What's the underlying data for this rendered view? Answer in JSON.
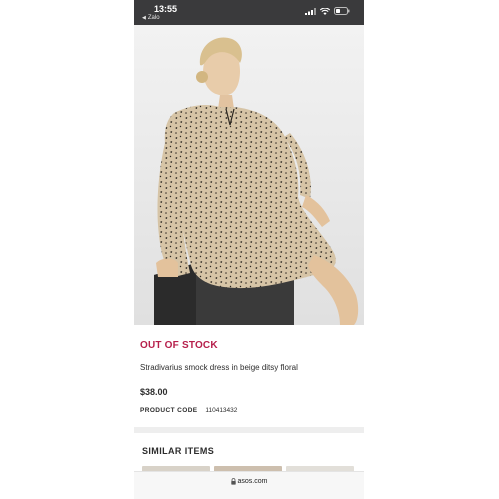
{
  "status_bar": {
    "time": "13:55",
    "back_app": "Zalo"
  },
  "product": {
    "stock_status": "OUT OF STOCK",
    "name": "Stradivarius smock dress in beige ditsy floral",
    "price": "$38.00",
    "code_label": "PRODUCT CODE",
    "code_value": "110413432"
  },
  "similar": {
    "title": "SIMILAR ITEMS"
  },
  "browser": {
    "url": "asos.com"
  },
  "colors": {
    "accent_out_of_stock": "#b61f4b",
    "status_bar_bg": "#3a3a3c"
  }
}
